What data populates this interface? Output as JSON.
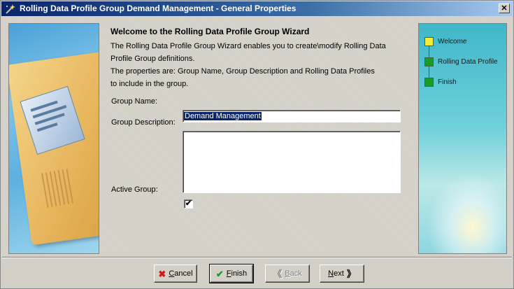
{
  "window": {
    "title": "Rolling Data Profile Group Demand Management - General Properties",
    "close_symbol": "✕"
  },
  "wizard": {
    "heading": "Welcome to the Rolling Data Profile Group Wizard",
    "description_lines": [
      "The Rolling Data Profile Group Wizard enables you to create\\modify Rolling Data",
      "Profile Group definitions.",
      "The properties are: Group Name, Group Description and Rolling Data Profiles",
      "to include in the group."
    ]
  },
  "form": {
    "group_name_label": "Group Name:",
    "group_name_value": "Demand Management",
    "group_description_label": "Group Description:",
    "group_description_value": "",
    "active_group_label": "Active Group:",
    "active_group_checked": true,
    "check_mark": "✔"
  },
  "steps": [
    {
      "label": "Welcome",
      "color": "#f5ec3a",
      "active": true
    },
    {
      "label": "Rolling Data Profile",
      "color": "#1a9a2a",
      "active": false
    },
    {
      "label": "Finish",
      "color": "#1a9a2a",
      "active": false
    }
  ],
  "buttons": {
    "cancel": {
      "label_rest": "ancel",
      "mnemonic": "C",
      "icon": "close-x-icon",
      "icon_glyph": "✖",
      "icon_color": "#d81818"
    },
    "finish": {
      "label_rest": "inish",
      "mnemonic": "F",
      "icon": "checkmark-icon",
      "icon_glyph": "✔",
      "icon_color": "#1a9a2a"
    },
    "back": {
      "label_rest": "ack",
      "mnemonic": "B",
      "icon": "double-left-arrow-icon",
      "icon_glyph": "《",
      "disabled": true
    },
    "next": {
      "label_rest": "ext",
      "mnemonic": "N",
      "icon": "double-right-arrow-icon",
      "icon_glyph": "》"
    }
  }
}
